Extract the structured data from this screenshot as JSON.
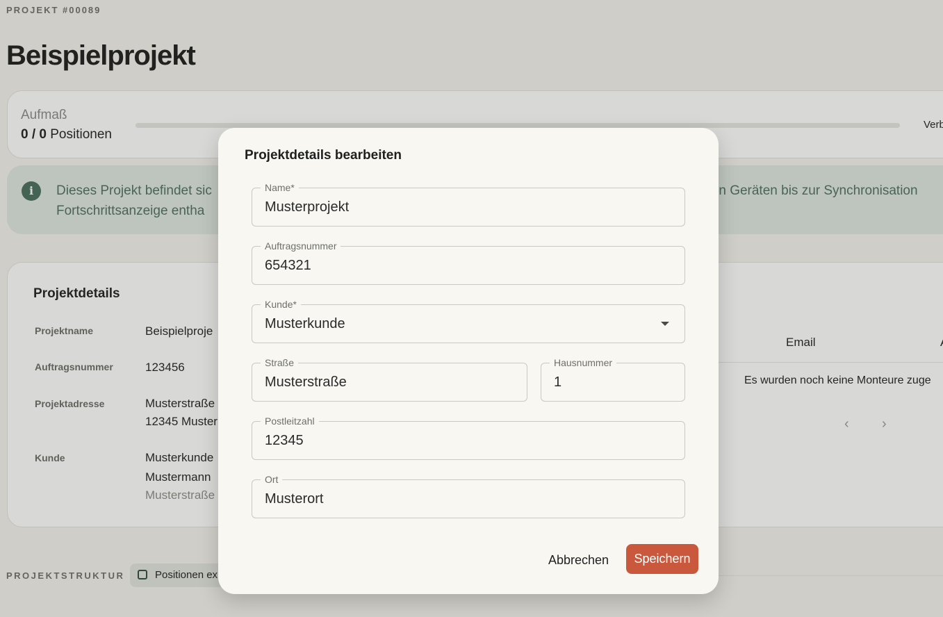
{
  "header": {
    "eyebrow": "PROJEKT #00089",
    "title": "Beispielprojekt"
  },
  "progress": {
    "label": "Aufmaß",
    "count_bold": "0 / 0",
    "count_suffix": " Positionen",
    "fraction": 0,
    "right_label": "Verb"
  },
  "info_banner": {
    "line1_left": "Dieses Projekt befindet sic",
    "line1_right": "eren Geräten bis zur Synchronisation",
    "line2": "Fortschrittsanzeige entha",
    "icon": "info-icon"
  },
  "details": {
    "title": "Projektdetails",
    "rows": [
      {
        "label": "Projektname",
        "value": "Beispielproje"
      },
      {
        "label": "Auftragsnummer",
        "value": "123456"
      },
      {
        "label": "Projektadresse",
        "value_line1": "Musterstraße",
        "value_line2": "12345 Muster"
      },
      {
        "label": "Kunde",
        "value_line1": "Musterkunde",
        "value_line2": "Mustermann",
        "value_line3": "Musterstraße"
      }
    ],
    "table": {
      "col_email": "Email",
      "col_next": "A",
      "empty": "Es wurden noch keine Monteure zuge"
    }
  },
  "structure": {
    "label": "PROJEKTSTRUKTUR",
    "export_button": "Positionen ex"
  },
  "dialog": {
    "title": "Projektdetails bearbeiten",
    "fields": {
      "name": {
        "label": "Name*",
        "value": "Musterprojekt"
      },
      "order": {
        "label": "Auftragsnummer",
        "value": "654321"
      },
      "customer": {
        "label": "Kunde*",
        "value": "Musterkunde"
      },
      "street": {
        "label": "Straße",
        "value": "Musterstraße"
      },
      "house": {
        "label": "Hausnummer",
        "value": "1"
      },
      "zip": {
        "label": "Postleitzahl",
        "value": "12345"
      },
      "city": {
        "label": "Ort",
        "value": "Musterort"
      }
    },
    "cancel": "Abbrechen",
    "save": "Speichern"
  },
  "colors": {
    "accent": "#c9583c",
    "info_bg": "#dfe8e2",
    "info_text": "#4d6f60"
  }
}
